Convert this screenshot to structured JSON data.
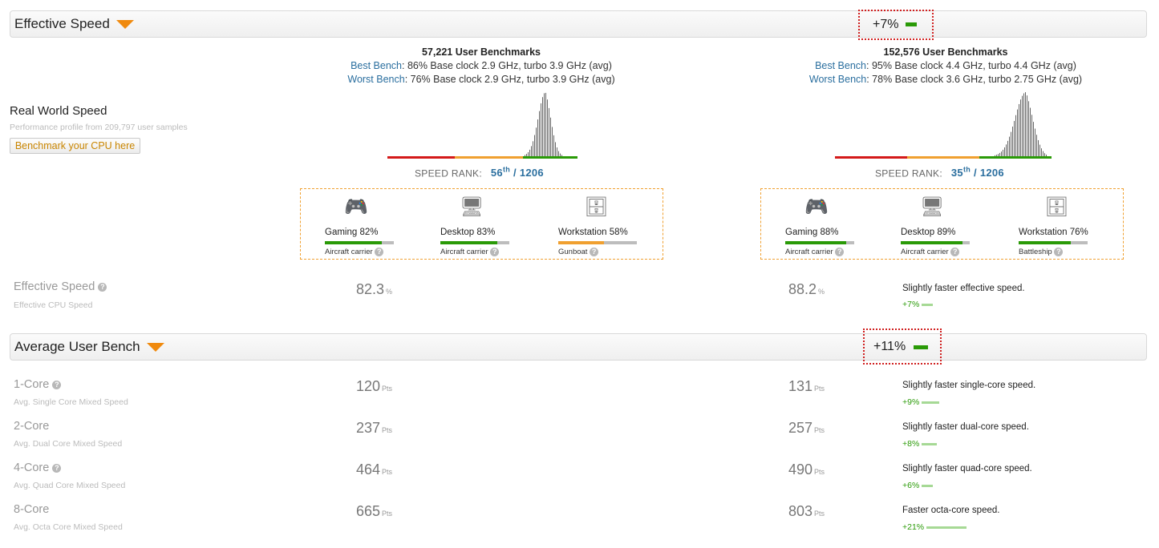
{
  "effective_speed_header": {
    "title": "Effective Speed",
    "diff": "+7%"
  },
  "real_world": {
    "title": "Real World Speed",
    "subtitle": "Performance profile from 209,797 user samples",
    "button": "Benchmark your CPU here"
  },
  "cpu1": {
    "bench_title": "57,221 User Benchmarks",
    "best_label": "Best Bench",
    "best_text": ": 86% Base clock 2.9 GHz, turbo 3.9 GHz (avg)",
    "worst_label": "Worst Bench",
    "worst_text": ": 76% Base clock 2.9 GHz, turbo 3.9 GHz (avg)",
    "speed_rank_label": "SPEED RANK:",
    "rank": "56",
    "rank_suffix": "th",
    "rank_total": "/ 1206",
    "usage": [
      {
        "label": "Gaming 82%",
        "value": 82,
        "color": "#2a9a07",
        "class": "Aircraft carrier",
        "icon": "gamepad-icon"
      },
      {
        "label": "Desktop 83%",
        "value": 83,
        "color": "#2a9a07",
        "class": "Aircraft carrier",
        "icon": "monitor-icon"
      },
      {
        "label": "Workstation 58%",
        "value": 58,
        "color": "#f0a030",
        "class": "Gunboat",
        "icon": "tower-icon"
      }
    ],
    "effective_speed": "82.3",
    "effective_unit": "%"
  },
  "cpu2": {
    "bench_title": "152,576 User Benchmarks",
    "best_label": "Best Bench",
    "best_text": ": 95% Base clock 4.4 GHz, turbo 4.4 GHz (avg)",
    "worst_label": "Worst Bench",
    "worst_text": ": 78% Base clock 3.6 GHz, turbo 2.75 GHz (avg)",
    "speed_rank_label": "SPEED RANK:",
    "rank": "35",
    "rank_suffix": "th",
    "rank_total": "/ 1206",
    "usage": [
      {
        "label": "Gaming 88%",
        "value": 88,
        "color": "#2a9a07",
        "class": "Aircraft carrier",
        "icon": "gamepad-icon"
      },
      {
        "label": "Desktop 89%",
        "value": 89,
        "color": "#2a9a07",
        "class": "Aircraft carrier",
        "icon": "monitor-icon"
      },
      {
        "label": "Workstation 76%",
        "value": 76,
        "color": "#2a9a07",
        "class": "Battleship",
        "icon": "tower-icon"
      }
    ],
    "effective_speed": "88.2",
    "effective_unit": "%"
  },
  "effective_row": {
    "label": "Effective Speed",
    "sub": "Effective CPU Speed",
    "comment": "Slightly faster effective speed.",
    "pct": "+7%"
  },
  "avg_header": {
    "title": "Average User Bench",
    "diff": "+11%"
  },
  "bench_rows": [
    {
      "label": "1-Core",
      "help": true,
      "sub": "Avg. Single Core Mixed Speed",
      "v1": "120",
      "v2": "131",
      "unit": "Pts",
      "comment": "Slightly faster single-core speed.",
      "pct": "+9%",
      "pct_value": 9
    },
    {
      "label": "2-Core",
      "help": false,
      "sub": "Avg. Dual Core Mixed Speed",
      "v1": "237",
      "v2": "257",
      "unit": "Pts",
      "comment": "Slightly faster dual-core speed.",
      "pct": "+8%",
      "pct_value": 8
    },
    {
      "label": "4-Core",
      "help": true,
      "sub": "Avg. Quad Core Mixed Speed",
      "v1": "464",
      "v2": "490",
      "unit": "Pts",
      "comment": "Slightly faster quad-core speed.",
      "pct": "+6%",
      "pct_value": 6
    },
    {
      "label": "8-Core",
      "help": false,
      "sub": "Avg. Octa Core Mixed Speed",
      "v1": "665",
      "v2": "803",
      "unit": "Pts",
      "comment": "Faster octa-core speed.",
      "pct": "+21%",
      "pct_value": 21
    }
  ],
  "colors": {
    "accent_orange": "#f08a0e",
    "positive_green": "#2a9a07",
    "link_blue": "#2b6f9f",
    "diff_border": "#d02020"
  }
}
